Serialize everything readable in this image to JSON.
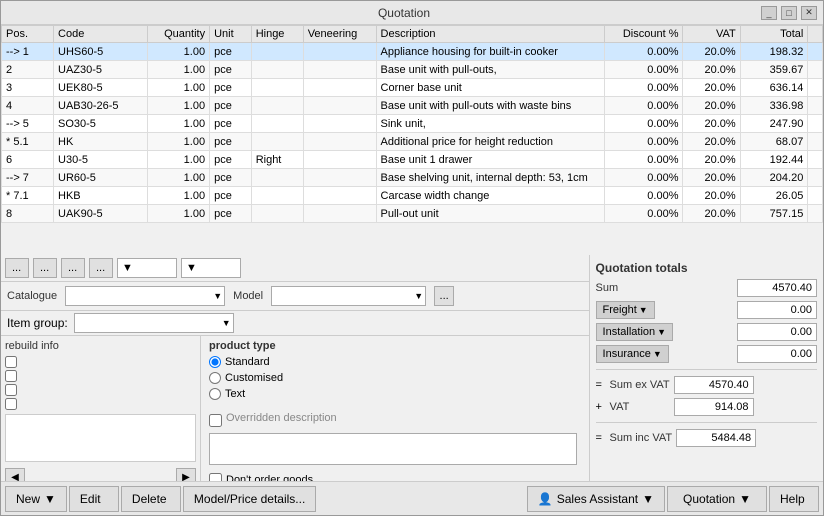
{
  "window": {
    "title": "Quotation"
  },
  "table": {
    "headers": [
      "Pos.",
      "Code",
      "Quantity",
      "Unit",
      "Hinge",
      "Veneering",
      "Description",
      "Discount %",
      "VAT",
      "Total"
    ],
    "rows": [
      {
        "pos": "--> 1",
        "code": "UHS60-5",
        "qty": "1.00",
        "unit": "pce",
        "hinge": "",
        "veneer": "",
        "desc": "Appliance housing for built-in cooker",
        "disc": "0.00%",
        "vat": "20.0%",
        "total": "198.32"
      },
      {
        "pos": "2",
        "code": "UAZ30-5",
        "qty": "1.00",
        "unit": "pce",
        "hinge": "",
        "veneer": "",
        "desc": "Base unit with pull-outs,",
        "disc": "0.00%",
        "vat": "20.0%",
        "total": "359.67"
      },
      {
        "pos": "3",
        "code": "UEK80-5",
        "qty": "1.00",
        "unit": "pce",
        "hinge": "",
        "veneer": "",
        "desc": "Corner base unit",
        "disc": "0.00%",
        "vat": "20.0%",
        "total": "636.14"
      },
      {
        "pos": "4",
        "code": "UAB30-26-5",
        "qty": "1.00",
        "unit": "pce",
        "hinge": "",
        "veneer": "",
        "desc": "Base unit with pull-outs with waste bins",
        "disc": "0.00%",
        "vat": "20.0%",
        "total": "336.98"
      },
      {
        "pos": "--> 5",
        "code": "SO30-5",
        "qty": "1.00",
        "unit": "pce",
        "hinge": "",
        "veneer": "",
        "desc": "Sink unit,",
        "disc": "0.00%",
        "vat": "20.0%",
        "total": "247.90"
      },
      {
        "pos": "* 5.1",
        "code": "HK",
        "qty": "1.00",
        "unit": "pce",
        "hinge": "",
        "veneer": "",
        "desc": "Additional price for height reduction",
        "disc": "0.00%",
        "vat": "20.0%",
        "total": "68.07"
      },
      {
        "pos": "6",
        "code": "U30-5",
        "qty": "1.00",
        "unit": "pce",
        "hinge": "Right",
        "veneer": "",
        "desc": "Base unit 1 drawer",
        "disc": "0.00%",
        "vat": "20.0%",
        "total": "192.44"
      },
      {
        "pos": "--> 7",
        "code": "UR60-5",
        "qty": "1.00",
        "unit": "pce",
        "hinge": "",
        "veneer": "",
        "desc": "Base shelving unit, internal depth: 53, 1cm",
        "disc": "0.00%",
        "vat": "20.0%",
        "total": "204.20"
      },
      {
        "pos": "* 7.1",
        "code": "HKB",
        "qty": "1.00",
        "unit": "pce",
        "hinge": "",
        "veneer": "",
        "desc": "Carcase width change",
        "disc": "0.00%",
        "vat": "20.0%",
        "total": "26.05"
      },
      {
        "pos": "8",
        "code": "UAK90-5",
        "qty": "1.00",
        "unit": "pce",
        "hinge": "",
        "veneer": "",
        "desc": "Pull-out unit",
        "disc": "0.00%",
        "vat": "20.0%",
        "total": "757.15"
      }
    ]
  },
  "toolbar": {
    "buttons": [
      "...",
      "...",
      "...",
      "...",
      "▼",
      "▼"
    ]
  },
  "catalogue": {
    "label": "Catalogue",
    "value": ""
  },
  "model": {
    "label": "Model",
    "value": ""
  },
  "item_group": {
    "label": "Item group:",
    "value": ""
  },
  "rebuild_info": {
    "label": "rebuild info",
    "checkboxes": [
      "",
      "",
      "",
      ""
    ]
  },
  "product_type": {
    "label": "product type",
    "options": [
      "Standard",
      "Customised",
      "Text"
    ],
    "selected": "Standard",
    "dont_order": "Don't order goods",
    "overridden_desc": "Overridden description"
  },
  "quotation_totals": {
    "title": "Quotation totals",
    "sum_label": "Sum",
    "sum_value": "4570.40",
    "freight_label": "Freight",
    "freight_value": "0.00",
    "installation_label": "Installation",
    "installation_value": "0.00",
    "insurance_label": "Insurance",
    "insurance_value": "0.00",
    "sum_ex_vat_label": "Sum ex VAT",
    "sum_ex_vat_value": "4570.40",
    "vat_label": "VAT",
    "vat_value": "914.08",
    "sum_inc_vat_label": "Sum inc VAT",
    "sum_inc_vat_value": "5484.48"
  },
  "bottom_toolbar": {
    "new_label": "New",
    "edit_label": "Edit",
    "delete_label": "Delete",
    "model_price_label": "Model/Price details...",
    "sales_assistant_label": "Sales Assistant",
    "quotation_label": "Quotation",
    "help_label": "Help"
  }
}
